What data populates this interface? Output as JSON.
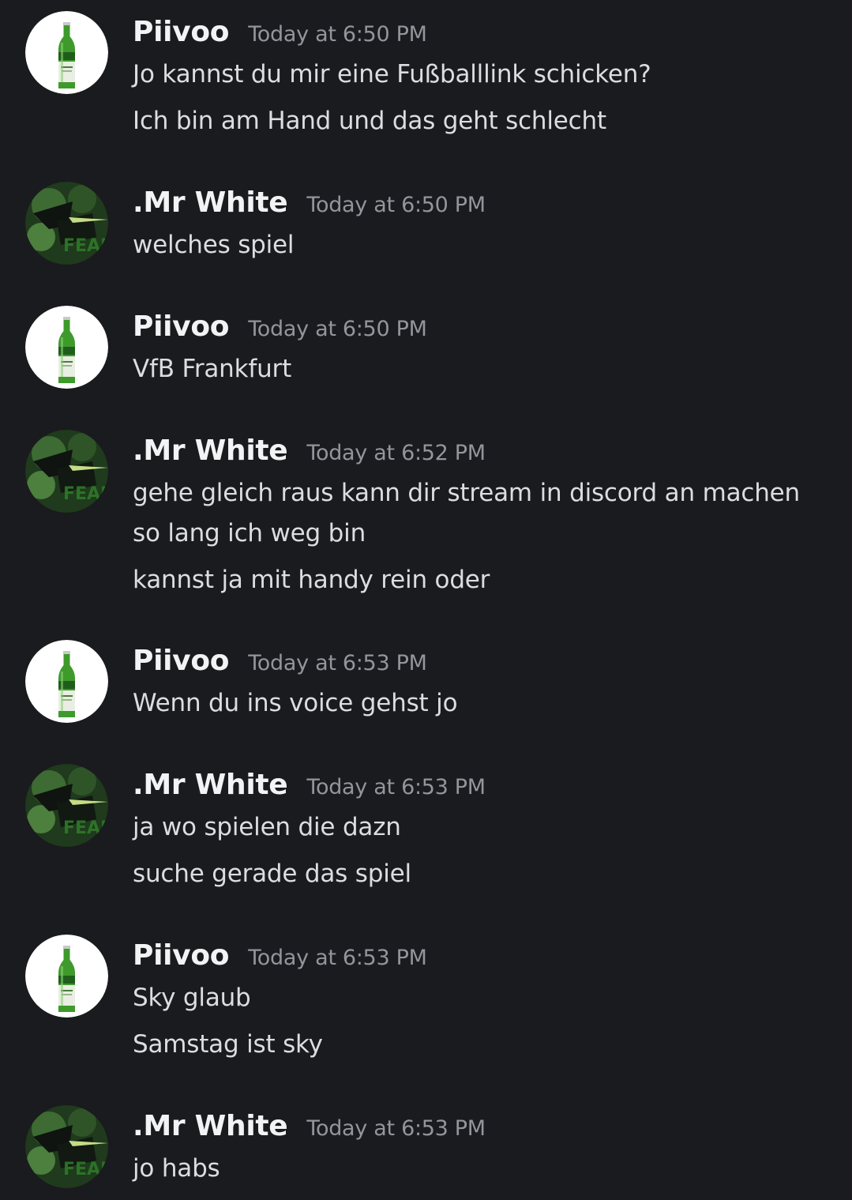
{
  "colors": {
    "background": "#1a1b1e",
    "username": "#f2f3f5",
    "timestamp": "#94959c",
    "message_text": "#dcdde1",
    "bottle_green": "#3f9a2c"
  },
  "users": {
    "piivoo": {
      "name": "Piivoo",
      "avatar_icon": "beer-bottle-avatar-icon"
    },
    "mrwhite": {
      "name": ".Mr White",
      "avatar_icon": "dark-green-team-logo-avatar-icon"
    }
  },
  "messages": [
    {
      "user": "Piivoo",
      "time": "Today at 6:50 PM",
      "lines": [
        "Jo kannst du mir eine Fußballlink schicken?",
        "Ich bin am Hand und das geht schlecht"
      ]
    },
    {
      "user": ".Mr White",
      "time": "Today at 6:50 PM",
      "lines": [
        "welches spiel"
      ]
    },
    {
      "user": "Piivoo",
      "time": "Today at 6:50 PM",
      "lines": [
        "VfB Frankfurt"
      ]
    },
    {
      "user": ".Mr White",
      "time": "Today at 6:52 PM",
      "lines": [
        "gehe gleich raus kann dir stream in discord an machen",
        "so lang ich weg bin",
        "kannst ja mit handy rein oder"
      ]
    },
    {
      "user": "Piivoo",
      "time": "Today at 6:53 PM",
      "lines": [
        "Wenn du ins voice gehst jo"
      ]
    },
    {
      "user": ".Mr White",
      "time": "Today at 6:53 PM",
      "lines": [
        "ja wo spielen die dazn",
        "suche gerade das spiel"
      ]
    },
    {
      "user": "Piivoo",
      "time": "Today at 6:53 PM",
      "lines": [
        "Sky glaub",
        "Samstag ist sky"
      ]
    },
    {
      "user": ".Mr White",
      "time": "Today at 6:53 PM",
      "lines": [
        "jo habs"
      ]
    }
  ]
}
